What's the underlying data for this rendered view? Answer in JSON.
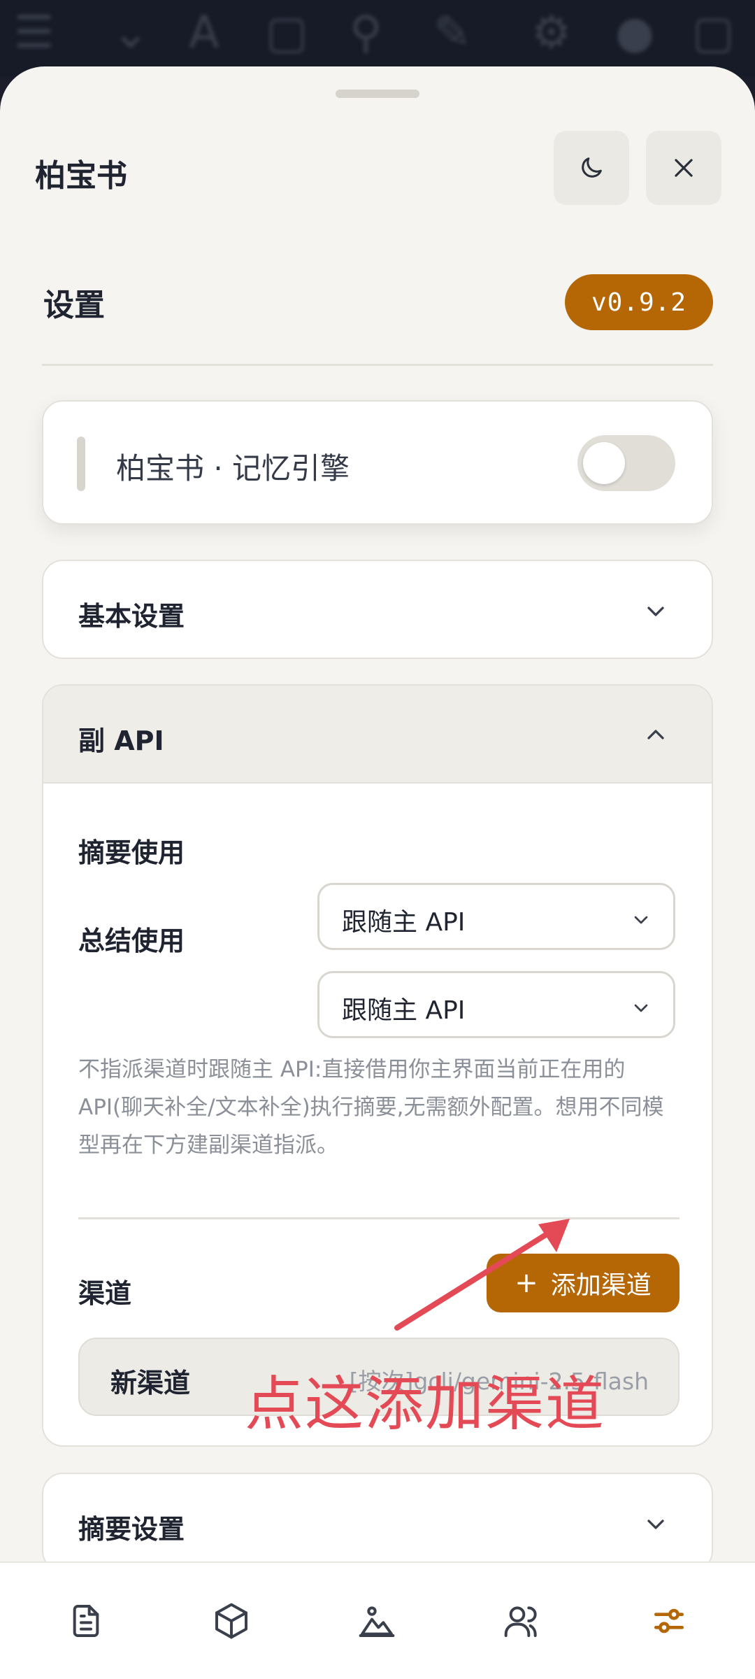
{
  "app": {
    "title": "柏宝书"
  },
  "header": {
    "settings_title": "设置",
    "version": "v0.9.2"
  },
  "engine": {
    "label": "柏宝书 · 记忆引擎",
    "enabled": false
  },
  "sections": {
    "basic": {
      "title": "基本设置",
      "expanded": false
    },
    "sub_api": {
      "title": "副 API",
      "expanded": true,
      "rows": [
        {
          "label": "摘要使用",
          "value": "跟随主 API"
        },
        {
          "label": "总结使用",
          "value": "跟随主 API"
        }
      ],
      "description": "不指派渠道时跟随主 API:直接借用你主界面当前正在用的API(聊天补全/文本补全)执行摘要,无需额外配置。想用不同模型再在下方建副渠道指派。",
      "channels_label": "渠道",
      "add_channel_label": "添加渠道",
      "channels": [
        {
          "name": "新渠道",
          "meta": "[按次]gcli/gemini-2.5-flash"
        }
      ]
    },
    "summary": {
      "title": "摘要设置",
      "expanded": false
    }
  },
  "annotation": {
    "text": "点这添加渠道",
    "color": "#e34a55"
  },
  "tabbar": {
    "active_index": 4,
    "items": [
      {
        "icon": "document-icon"
      },
      {
        "icon": "cube-icon"
      },
      {
        "icon": "landscape-icon"
      },
      {
        "icon": "users-icon"
      },
      {
        "icon": "sliders-icon"
      }
    ]
  },
  "colors": {
    "accent": "#b56705",
    "background": "#f5f4f1",
    "annotation": "#e34a55"
  }
}
